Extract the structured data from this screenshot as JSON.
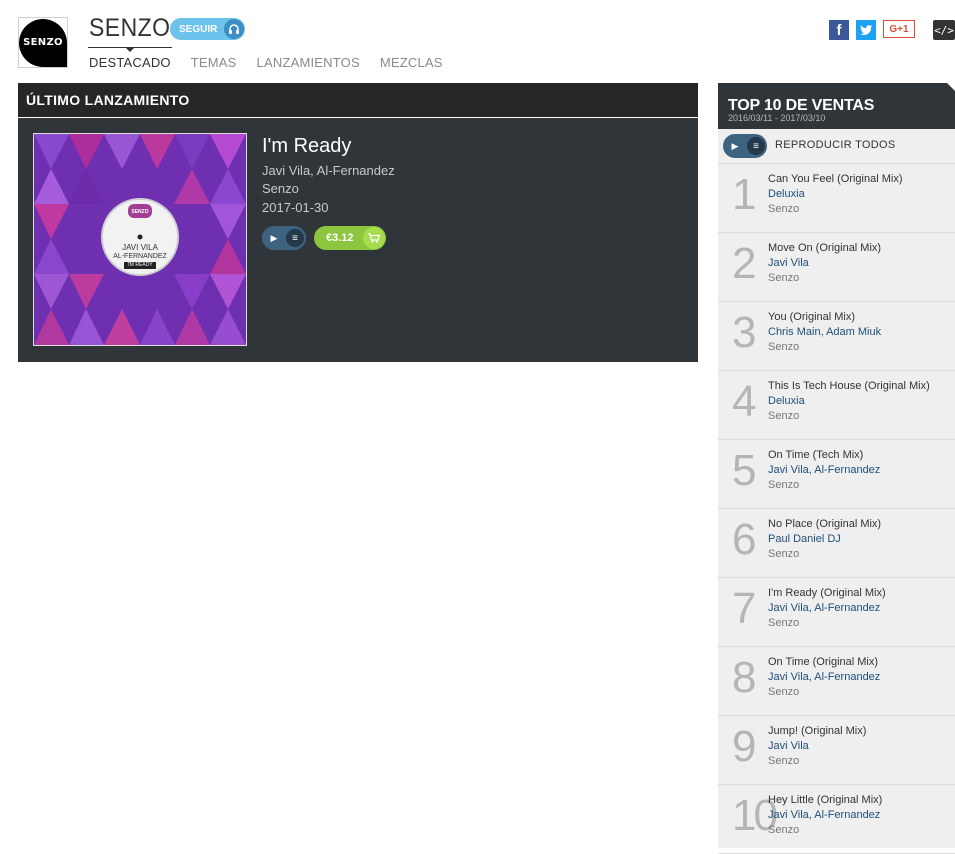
{
  "header": {
    "logo_text": "SENZO",
    "label_name": "SENZO",
    "follow_label": "SEGUIR",
    "tabs": [
      {
        "label": "DESTACADO",
        "active": true
      },
      {
        "label": "TEMAS",
        "active": false
      },
      {
        "label": "LANZAMIENTOS",
        "active": false
      },
      {
        "label": "MEZCLAS",
        "active": false
      }
    ],
    "social": {
      "facebook": "f",
      "twitter": "t",
      "googleplus": "G+1",
      "embed": "</>"
    }
  },
  "latest": {
    "heading": "ÚLTIMO LANZAMIENTO",
    "title": "I'm Ready",
    "artists": "Javi Vila, Al-Fernandez",
    "label": "Senzo",
    "date": "2017-01-30",
    "price": "€3.12",
    "cover_text": {
      "logo": "SENZO",
      "artist_line1": "JAVI VILA",
      "artist_line2": "AL-FERNANDEZ",
      "title": "I'M READY"
    }
  },
  "top10": {
    "title": "TOP 10 DE VENTAS",
    "range": "2016/03/11 - 2017/03/10",
    "play_all": "REPRODUCIR TODOS",
    "items": [
      {
        "rank": "1",
        "title": "Can You Feel (Original Mix)",
        "artists": "Deluxia",
        "label": "Senzo"
      },
      {
        "rank": "2",
        "title": "Move On (Original Mix)",
        "artists": "Javi Vila",
        "label": "Senzo"
      },
      {
        "rank": "3",
        "title": "You (Original Mix)",
        "artists": "Chris Main, Adam Miuk",
        "label": "Senzo"
      },
      {
        "rank": "4",
        "title": "This Is Tech House (Original Mix)",
        "artists": "Deluxia",
        "label": "Senzo"
      },
      {
        "rank": "5",
        "title": "On Time (Tech Mix)",
        "artists": "Javi Vila, Al-Fernandez",
        "label": "Senzo"
      },
      {
        "rank": "6",
        "title": "No Place (Original Mix)",
        "artists": "Paul Daniel DJ",
        "label": "Senzo"
      },
      {
        "rank": "7",
        "title": "I'm Ready (Original Mix)",
        "artists": "Javi Vila, Al-Fernandez",
        "label": "Senzo"
      },
      {
        "rank": "8",
        "title": "On Time (Original Mix)",
        "artists": "Javi Vila, Al-Fernandez",
        "label": "Senzo"
      },
      {
        "rank": "9",
        "title": "Jump! (Original Mix)",
        "artists": "Javi Vila",
        "label": "Senzo"
      },
      {
        "rank": "10",
        "title": "Hey Little (Original Mix)",
        "artists": "Javi Vila, Al-Fernandez",
        "label": "Senzo"
      }
    ]
  },
  "icons": {
    "play": "play-icon",
    "queue": "queue-list-icon",
    "cart": "cart-icon",
    "headphones": "headphones-icon"
  },
  "colors": {
    "dark_panel": "#2f3538",
    "follow_blue": "#6bc3ec",
    "buy_green": "#8cc63f",
    "artist_link": "#1f4f7a"
  }
}
